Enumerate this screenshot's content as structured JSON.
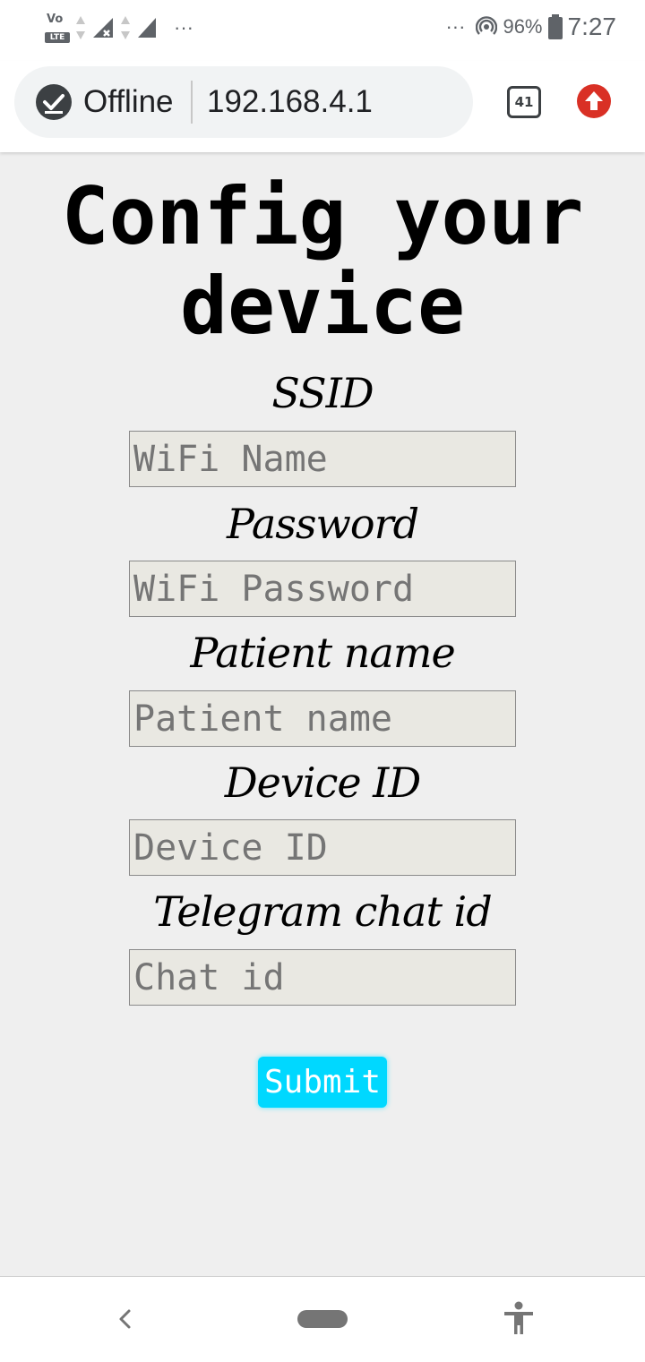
{
  "status_bar": {
    "volte_label": "Vo",
    "lte_label": "LTE",
    "left_dots": "···",
    "right_dots": "···",
    "battery": "96%",
    "time": "7:27"
  },
  "toolbar": {
    "offline_label": "Offline",
    "url": "192.168.4.1",
    "tab_count": "41"
  },
  "page": {
    "title": "Config your device",
    "fields": [
      {
        "label": "SSID",
        "placeholder": "WiFi Name",
        "value": ""
      },
      {
        "label": "Password",
        "placeholder": "WiFi Password",
        "value": ""
      },
      {
        "label": "Patient name",
        "placeholder": "Patient name",
        "value": ""
      },
      {
        "label": "Device ID",
        "placeholder": "Device ID",
        "value": ""
      },
      {
        "label": "Telegram chat id",
        "placeholder": "Chat id",
        "value": ""
      }
    ],
    "submit_label": "Submit"
  },
  "colors": {
    "submit_bg": "#00d8ff",
    "update_icon": "#d93025",
    "page_bg": "#efefef",
    "input_bg": "#e9e8e2"
  },
  "icons": {
    "offline": "offline-check-icon",
    "update": "update-arrow-icon",
    "back": "back-chevron-icon",
    "accessibility": "accessibility-icon"
  }
}
